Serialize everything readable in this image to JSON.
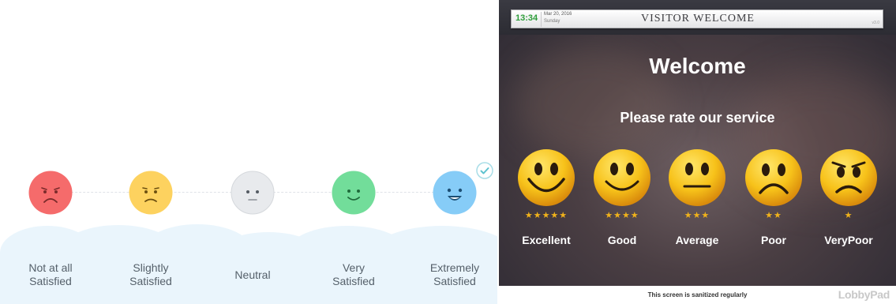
{
  "left_panel": {
    "options": [
      {
        "line1": "Not at all",
        "line2": "Satisfied",
        "mood": "very-sad",
        "color": "#f56b6b"
      },
      {
        "line1": "Slightly",
        "line2": "Satisfied",
        "mood": "sad",
        "color": "#fdd25f"
      },
      {
        "line1": "Neutral",
        "line2": "",
        "mood": "neutral",
        "color": "#e8eaed"
      },
      {
        "line1": "Very",
        "line2": "Satisfied",
        "mood": "smile",
        "color": "#72dd9a"
      },
      {
        "line1": "Extremely",
        "line2": "Satisfied",
        "mood": "big-smile",
        "color": "#86ccf7"
      }
    ],
    "selected_index": 4,
    "selected_icon": "check-icon",
    "cloud_color": "#eaf5fc"
  },
  "right_panel": {
    "header": {
      "time": "13:34",
      "date": "Mar 20, 2016",
      "day": "Sunday",
      "title": "VISITOR WELCOME",
      "version": "v3.0"
    },
    "welcome": "Welcome",
    "prompt": "Please rate our service",
    "ratings": [
      {
        "label": "Excellent",
        "stars": "★★★★★",
        "star_count": 5,
        "icon": "grin-emoji-icon"
      },
      {
        "label": "Good",
        "stars": "★★★★",
        "star_count": 4,
        "icon": "smile-emoji-icon"
      },
      {
        "label": "Average",
        "stars": "★★★",
        "star_count": 3,
        "icon": "neutral-emoji-icon"
      },
      {
        "label": "Poor",
        "stars": "★★",
        "star_count": 2,
        "icon": "frown-emoji-icon"
      },
      {
        "label": "VeryPoor",
        "stars": "★",
        "star_count": 1,
        "icon": "angry-emoji-icon"
      }
    ],
    "footer": {
      "notice": "This screen is sanitized regularly",
      "logo": "LobbyPad"
    },
    "colors": {
      "star": "#f0b21b",
      "emoji": "#f7c21a",
      "clock": "#2e9e3b"
    }
  }
}
